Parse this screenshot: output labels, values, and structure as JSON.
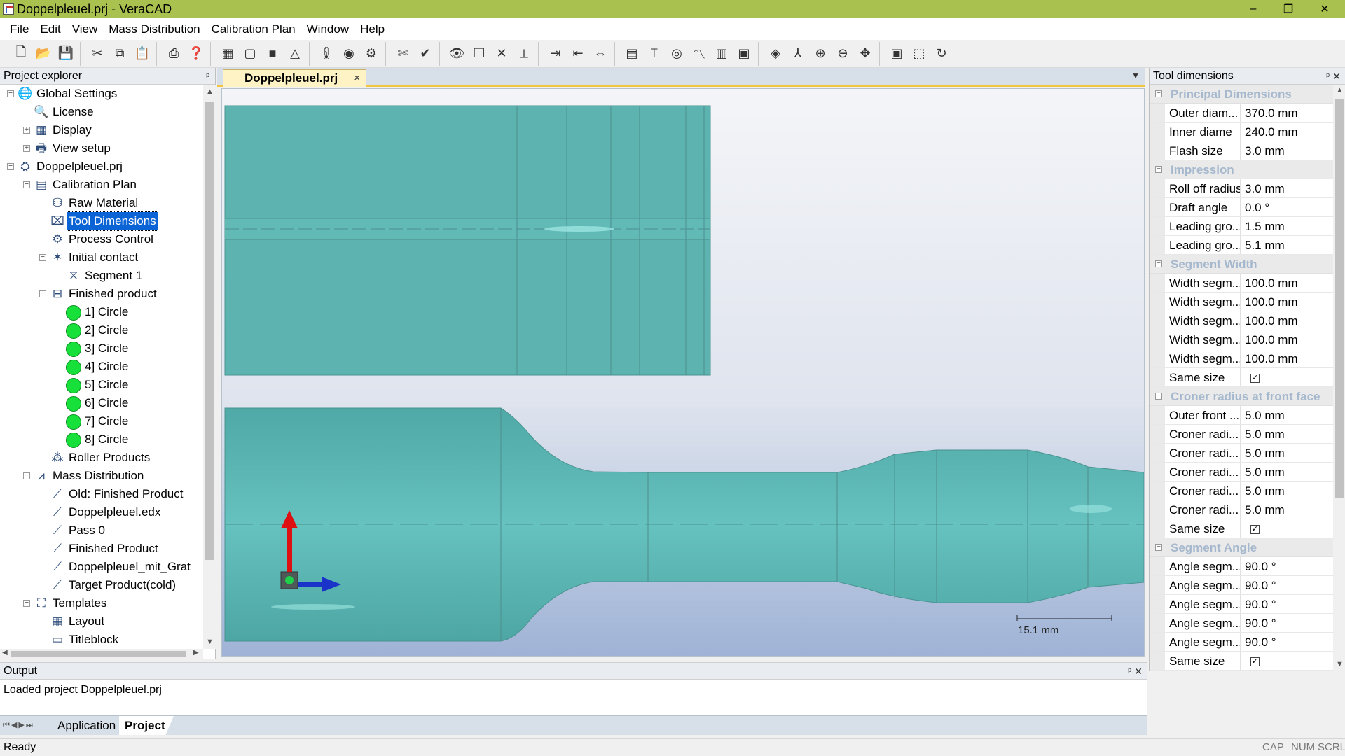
{
  "window": {
    "title": "Doppelpleuel.prj - VeraCAD",
    "minimize": "–",
    "maximize": "❐",
    "close": "✕"
  },
  "menu": [
    "File",
    "Edit",
    "View",
    "Mass Distribution",
    "Calibration Plan",
    "Window",
    "Help"
  ],
  "toolbar_icons": [
    [
      "new-file-icon",
      "open-folder-icon",
      "save-icon"
    ],
    [
      "cut-icon",
      "copy-icon",
      "paste-icon"
    ],
    [
      "print-icon",
      "help-icon"
    ],
    [
      "tool-frame-icon",
      "box-outline-icon",
      "box-solid-icon",
      "triangle-warning-icon"
    ],
    [
      "thermometer-icon",
      "eye-dropdown-icon",
      "calibration-dropdown-icon"
    ],
    [
      "scissors-icon",
      "check-flag-icon"
    ],
    [
      "eye-icon",
      "copy-window-icon",
      "delete-x-icon",
      "measure-icon"
    ],
    [
      "export-icon",
      "import-icon",
      "align-icon"
    ],
    [
      "layout-grid-icon",
      "pass-design-icon",
      "roll-icon",
      "chart-icon",
      "table-icon",
      "cad-icon"
    ],
    [
      "select-3d-icon",
      "axes-icon",
      "zoom-in-icon",
      "zoom-out-icon",
      "pan-icon"
    ],
    [
      "fit-view-icon",
      "zoom-window-icon",
      "rotate-icon"
    ]
  ],
  "explorer": {
    "title": "Project explorer",
    "items": [
      {
        "label": "Global Settings",
        "level": 0,
        "exp": "−",
        "icon": "globe-icon"
      },
      {
        "label": "License",
        "level": 1,
        "icon": "license-icon"
      },
      {
        "label": "Display",
        "level": 1,
        "exp": "+",
        "icon": "display-icon"
      },
      {
        "label": "View setup",
        "level": 1,
        "exp": "+",
        "icon": "view-setup-icon"
      },
      {
        "label": "Doppelpleuel.prj",
        "level": 0,
        "exp": "−",
        "icon": "project-icon"
      },
      {
        "label": "Calibration Plan",
        "level": 1,
        "exp": "−",
        "icon": "calibration-plan-icon"
      },
      {
        "label": "Raw Material",
        "level": 2,
        "icon": "raw-material-icon"
      },
      {
        "label": "Tool Dimensions",
        "level": 2,
        "icon": "tool-dimensions-icon",
        "selected": true
      },
      {
        "label": "Process Control",
        "level": 2,
        "icon": "gear-icon"
      },
      {
        "label": "Initial contact",
        "level": 2,
        "exp": "−",
        "icon": "initial-contact-icon"
      },
      {
        "label": "Segment 1",
        "level": 3,
        "icon": "segment-icon"
      },
      {
        "label": "Finished product",
        "level": 2,
        "exp": "−",
        "icon": "finished-product-icon"
      },
      {
        "label": "1] Circle",
        "level": 3,
        "icon": "green-circle-icon"
      },
      {
        "label": "2] Circle",
        "level": 3,
        "icon": "green-circle-icon"
      },
      {
        "label": "3] Circle",
        "level": 3,
        "icon": "green-circle-icon"
      },
      {
        "label": "4] Circle",
        "level": 3,
        "icon": "green-circle-icon"
      },
      {
        "label": "5] Circle",
        "level": 3,
        "icon": "green-circle-icon"
      },
      {
        "label": "6] Circle",
        "level": 3,
        "icon": "green-circle-icon"
      },
      {
        "label": "7] Circle",
        "level": 3,
        "icon": "green-circle-icon"
      },
      {
        "label": "8] Circle",
        "level": 3,
        "icon": "green-circle-icon"
      },
      {
        "label": "Roller Products",
        "level": 2,
        "icon": "roller-products-icon"
      },
      {
        "label": "Mass Distribution",
        "level": 1,
        "exp": "−",
        "icon": "mass-distribution-icon"
      },
      {
        "label": "Old: Finished Product",
        "level": 2,
        "icon": "chart-doc-icon"
      },
      {
        "label": "Doppelpleuel.edx",
        "level": 2,
        "icon": "chart-doc-icon"
      },
      {
        "label": "Pass 0",
        "level": 2,
        "icon": "chart-doc-icon"
      },
      {
        "label": "Finished Product",
        "level": 2,
        "icon": "chart-doc-icon"
      },
      {
        "label": "Doppelpleuel_mit_Grat",
        "level": 2,
        "icon": "chart-doc-icon"
      },
      {
        "label": "Target Product(cold)",
        "level": 2,
        "icon": "chart-doc-icon"
      },
      {
        "label": "Templates",
        "level": 1,
        "exp": "−",
        "icon": "templates-icon"
      },
      {
        "label": "Layout",
        "level": 2,
        "icon": "layout-icon"
      },
      {
        "label": "Titleblock",
        "level": 2,
        "icon": "titleblock-icon"
      }
    ]
  },
  "document": {
    "tab": "Doppelpleuel.prj",
    "tab_close": "×",
    "scale_label": "15.1 mm"
  },
  "properties": {
    "title": "Tool dimensions",
    "categories": [
      {
        "name": "Principal Dimensions",
        "rows": [
          {
            "name": "Outer diam...",
            "value": "370.0 mm"
          },
          {
            "name": "Inner diame",
            "value": "240.0 mm"
          },
          {
            "name": "Flash size",
            "value": "3.0 mm"
          }
        ]
      },
      {
        "name": "Impression",
        "rows": [
          {
            "name": "Roll off radius",
            "value": "3.0 mm"
          },
          {
            "name": "Draft angle",
            "value": "0.0 °"
          },
          {
            "name": "Leading gro...",
            "value": "1.5 mm"
          },
          {
            "name": "Leading gro...",
            "value": "5.1 mm"
          }
        ]
      },
      {
        "name": "Segment Width",
        "rows": [
          {
            "name": "Width segm...",
            "value": "100.0 mm"
          },
          {
            "name": "Width segm...",
            "value": "100.0 mm"
          },
          {
            "name": "Width segm...",
            "value": "100.0 mm"
          },
          {
            "name": "Width segm...",
            "value": "100.0 mm"
          },
          {
            "name": "Width segm...",
            "value": "100.0 mm"
          },
          {
            "name": "Same size",
            "check": "☑"
          }
        ]
      },
      {
        "name": "Croner radius at front face",
        "rows": [
          {
            "name": "Outer front ...",
            "value": "5.0 mm"
          },
          {
            "name": "Croner radi...",
            "value": "5.0 mm"
          },
          {
            "name": "Croner radi...",
            "value": "5.0 mm"
          },
          {
            "name": "Croner radi...",
            "value": "5.0 mm"
          },
          {
            "name": "Croner radi...",
            "value": "5.0 mm"
          },
          {
            "name": "Croner radi...",
            "value": "5.0 mm"
          },
          {
            "name": "Same size",
            "check": "☑"
          }
        ]
      },
      {
        "name": "Segment Angle",
        "rows": [
          {
            "name": "Angle segm...",
            "value": "90.0 °"
          },
          {
            "name": "Angle segm...",
            "value": "90.0 °"
          },
          {
            "name": "Angle segm...",
            "value": "90.0 °"
          },
          {
            "name": "Angle segm...",
            "value": "90.0 °"
          },
          {
            "name": "Angle segm...",
            "value": "90.0 °"
          },
          {
            "name": "Same size",
            "check": "☑"
          }
        ]
      }
    ]
  },
  "output": {
    "title": "Output",
    "text": "Loaded project Doppelpleuel.prj"
  },
  "bottom_tabs": {
    "application": "Application",
    "project": "Project"
  },
  "status": {
    "text": "Ready",
    "cap": "CAP",
    "num": "NUM",
    "scrl": "SCRL"
  },
  "colors": {
    "titlebar": "#a9c24f",
    "selection": "#0a64d6",
    "model": "#5fb6b4",
    "category_text": "#a5b8cd"
  }
}
